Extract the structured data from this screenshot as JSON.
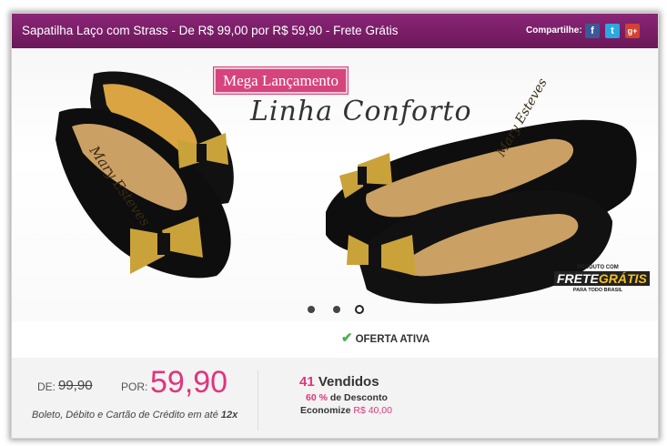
{
  "header": {
    "title": "Sapatilha Laço com Strass - De R$ 99,00 por R$ 59,90 - Frete Grátis",
    "share_label": "Compartilhe:",
    "social": [
      {
        "name": "facebook",
        "glyph": "f",
        "color": "#3b5998"
      },
      {
        "name": "twitter",
        "glyph": "t",
        "color": "#2aa9e0"
      },
      {
        "name": "google-plus",
        "glyph": "g+",
        "color": "#d44132"
      }
    ]
  },
  "banner": {
    "tag": "Mega Lançamento",
    "headline": "Linha Conforto",
    "badge": {
      "line1": "PRODUTO COM",
      "line2a": "FRETE",
      "line2b": "GRÁTIS",
      "line3": "PARA TODO BRASIL"
    },
    "insole_text": "Mary Esteves",
    "carousel": {
      "total": 3,
      "active": 3
    }
  },
  "offer": {
    "status": "OFERTA ATIVA"
  },
  "pricing": {
    "de_label": "DE:",
    "de_value": "99,90",
    "por_label": "POR:",
    "por_value": "59,90",
    "payment_text": "Boleto, Débito e Cartão de Crédito em até",
    "installments": "12x"
  },
  "stats": {
    "sold_count": "41",
    "sold_label": "Vendidos",
    "discount_pct": "60 %",
    "discount_label": "de Desconto",
    "economize_label": "Economize",
    "economize_value": "R$ 40,00"
  },
  "colors": {
    "brand": "#7e1f6b",
    "accent": "#e0357c",
    "check": "#4caf50"
  }
}
